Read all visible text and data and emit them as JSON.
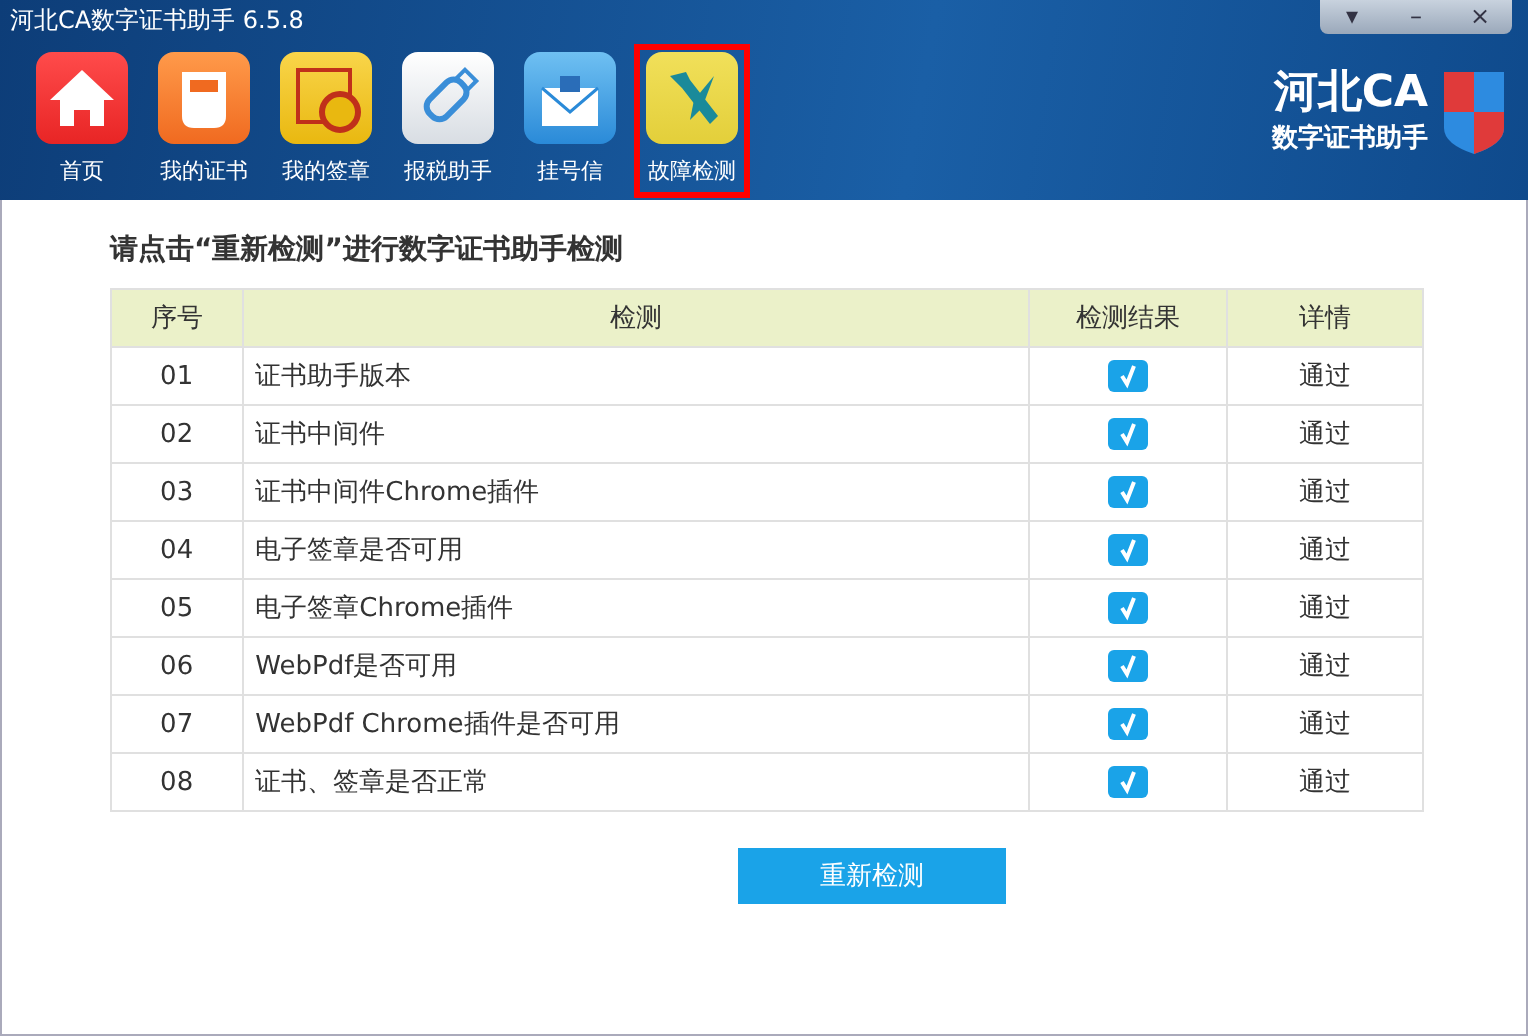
{
  "window": {
    "title": "河北CA数字证书助手  6.5.8",
    "controls": [
      "▾",
      "–",
      "×"
    ]
  },
  "nav": [
    {
      "label": "首页",
      "kind": "home",
      "selected": false
    },
    {
      "label": "我的证书",
      "kind": "cert",
      "selected": false
    },
    {
      "label": "我的签章",
      "kind": "seal",
      "selected": false
    },
    {
      "label": "报税助手",
      "kind": "usb",
      "selected": false
    },
    {
      "label": "挂号信",
      "kind": "mail",
      "selected": false
    },
    {
      "label": "故障检测",
      "kind": "tools",
      "selected": true
    }
  ],
  "brand": {
    "name": "河北CA",
    "subtitle": "数字证书助手"
  },
  "heading": "请点击“重新检测”进行数字证书助手检测",
  "table": {
    "columns": [
      "序号",
      "检测",
      "检测结果",
      "详情"
    ],
    "rows": [
      {
        "no": "01",
        "item": "证书助手版本",
        "checked": true,
        "detail": "通过"
      },
      {
        "no": "02",
        "item": "证书中间件",
        "checked": true,
        "detail": "通过"
      },
      {
        "no": "03",
        "item": "证书中间件Chrome插件",
        "checked": true,
        "detail": "通过"
      },
      {
        "no": "04",
        "item": "电子签章是否可用",
        "checked": true,
        "detail": "通过"
      },
      {
        "no": "05",
        "item": "电子签章Chrome插件",
        "checked": true,
        "detail": "通过"
      },
      {
        "no": "06",
        "item": "WebPdf是否可用",
        "checked": true,
        "detail": "通过"
      },
      {
        "no": "07",
        "item": "WebPdf Chrome插件是否可用",
        "checked": true,
        "detail": "通过"
      },
      {
        "no": "08",
        "item": "证书、签章是否正常",
        "checked": true,
        "detail": "通过"
      }
    ]
  },
  "button": "重新检测"
}
